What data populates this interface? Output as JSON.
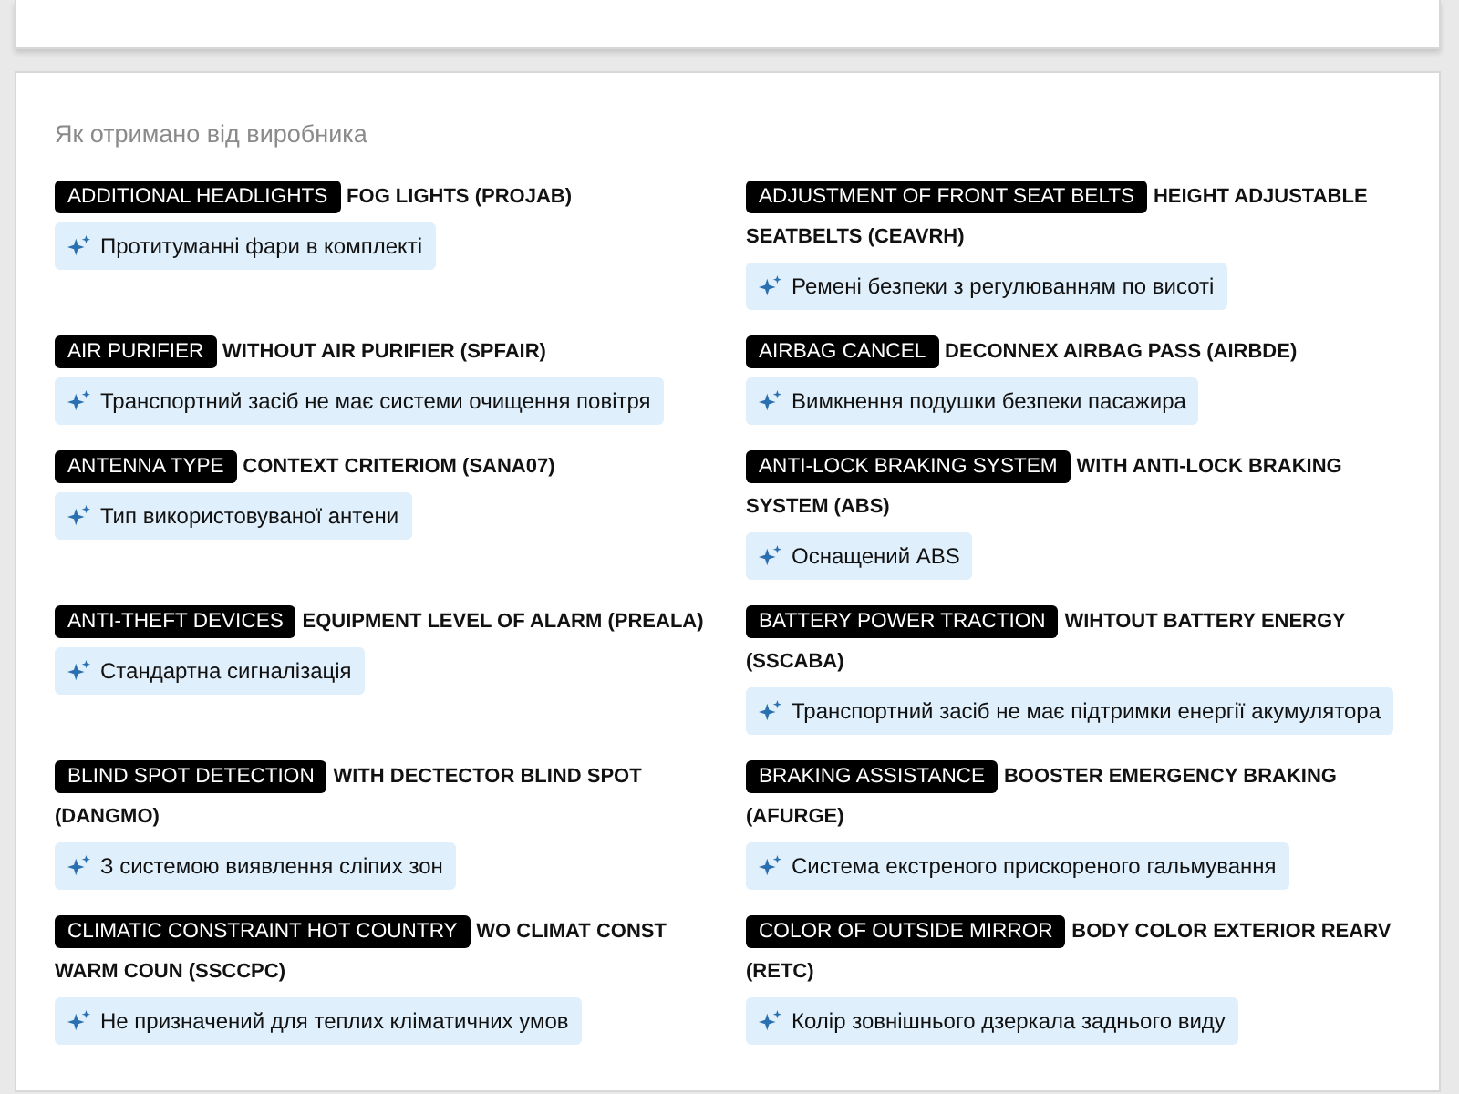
{
  "section": {
    "heading": "Як отримано від виробника",
    "items": [
      {
        "name": "ADDITIONAL HEADLIGHTS",
        "value_lines": [
          "FOG LIGHTS (PROJAB)"
        ],
        "description": "Протитуманні фари в комплекті"
      },
      {
        "name": "ADJUSTMENT OF FRONT SEAT BELTS",
        "value_lines": [
          "HEIGHT ADJUSTABLE",
          "SEATBELTS (CEAVRH)"
        ],
        "description": "Ремені безпеки з регулюванням по висоті"
      },
      {
        "name": "AIR PURIFIER",
        "value_lines": [
          "WITHOUT AIR PURIFIER (SPFAIR)"
        ],
        "description": "Транспортний засіб не має системи очищення повітря"
      },
      {
        "name": "AIRBAG CANCEL",
        "value_lines": [
          "DECONNEX AIRBAG PASS (AIRBDE)"
        ],
        "description": "Вимкнення подушки безпеки пасажира"
      },
      {
        "name": "ANTENNA TYPE",
        "value_lines": [
          "CONTEXT CRITERIOM (SANA07)"
        ],
        "description": "Тип використовуваної антени"
      },
      {
        "name": "ANTI-LOCK BRAKING SYSTEM",
        "value_lines": [
          "WITH ANTI-LOCK BRAKING",
          "SYSTEM (ABS)"
        ],
        "description": "Оснащений ABS"
      },
      {
        "name": "ANTI-THEFT DEVICES",
        "value_lines": [
          "EQUIPMENT LEVEL OF ALARM (PREALA)"
        ],
        "description": "Стандартна сигналізація"
      },
      {
        "name": "BATTERY POWER TRACTION",
        "value_lines": [
          "WIHTOUT BATTERY ENERGY",
          "(SSCABA)"
        ],
        "description": "Транспортний засіб не має підтримки енергії акумулятора"
      },
      {
        "name": "BLIND SPOT DETECTION",
        "value_lines": [
          "WITH DECTECTOR BLIND SPOT",
          "(DANGMO)"
        ],
        "description": "З системою виявлення сліпих зон"
      },
      {
        "name": "BRAKING ASSISTANCE",
        "value_lines": [
          "BOOSTER EMERGENCY BRAKING",
          "(AFURGE)"
        ],
        "description": "Система екстреного прискореного гальмування"
      },
      {
        "name": "CLIMATIC CONSTRAINT HOT COUNTRY",
        "value_lines": [
          "WO CLIMAT CONST",
          "WARM COUN (SSCCPC)"
        ],
        "description": "Не призначений для теплих кліматичних умов"
      },
      {
        "name": "COLOR OF OUTSIDE MIRROR",
        "value_lines": [
          "BODY COLOR EXTERIOR REARV",
          "(RETC)"
        ],
        "description": "Колір зовнішнього дзеркала заднього виду"
      }
    ]
  }
}
